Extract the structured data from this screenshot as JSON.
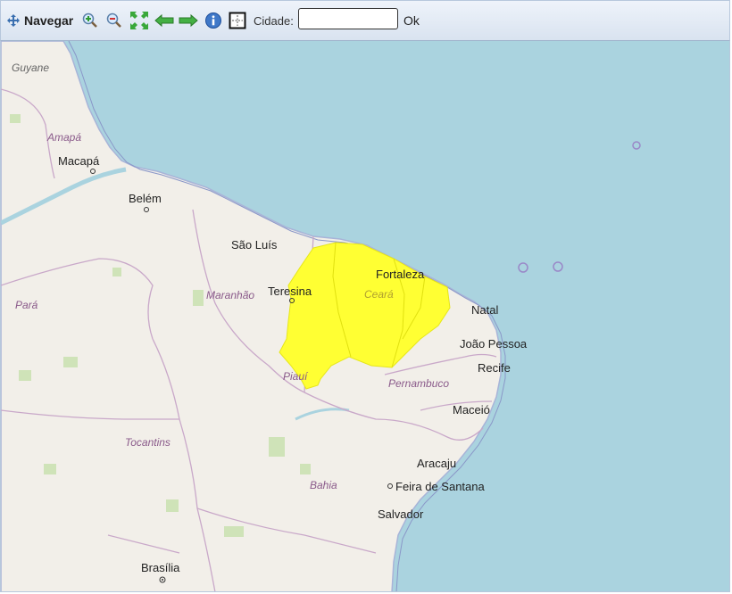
{
  "toolbar": {
    "navigate_label": "Navegar",
    "city_label": "Cidade:",
    "city_value": "",
    "ok_label": "Ok",
    "icons": [
      "navigate-icon",
      "zoom-in-icon",
      "zoom-out-icon",
      "zoom-extent-icon",
      "back-arrow-icon",
      "forward-arrow-icon",
      "info-icon",
      "select-box-icon"
    ]
  },
  "map": {
    "colors": {
      "sea": "#aad3df",
      "land": "#f2efe9",
      "alert": "#ffff33",
      "border": "#c9a8c9",
      "coast": "#8a97c8"
    },
    "labels": {
      "guyane": "Guyane",
      "amapa": "Amapá",
      "macapa": "Macapá",
      "belem": "Belém",
      "sao_luis": "São Luís",
      "teresina": "Teresina",
      "fortaleza": "Fortaleza",
      "ceara": "Ceará",
      "maranhao": "Maranhão",
      "para": "Pará",
      "piaui": "Piauí",
      "natal": "Natal",
      "joao_pessoa": "João Pessoa",
      "recife": "Recife",
      "pernambuco": "Pernambuco",
      "maceio": "Maceió",
      "tocantins": "Tocantins",
      "aracaju": "Aracaju",
      "bahia": "Bahia",
      "feira_de_santana": "Feira de Santana",
      "salvador": "Salvador",
      "brasilia": "Brasília"
    }
  }
}
